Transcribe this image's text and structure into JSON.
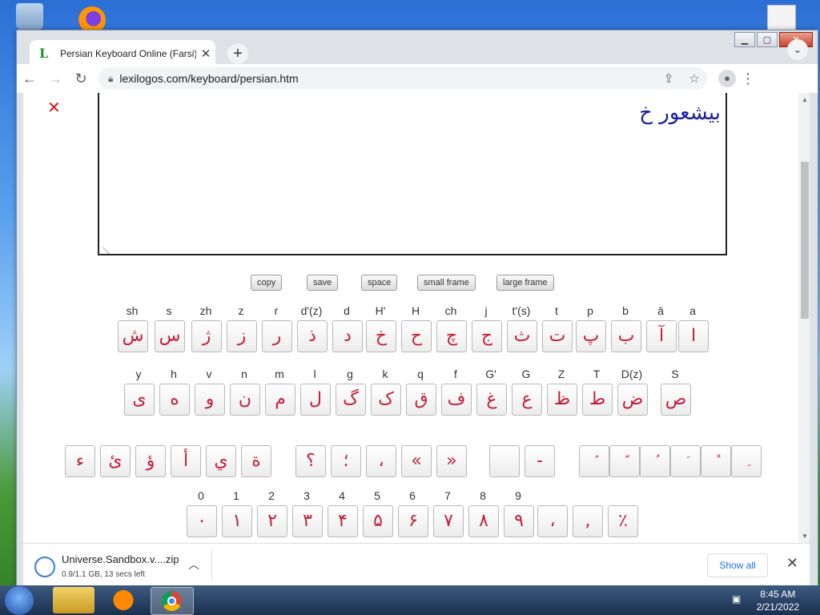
{
  "browser": {
    "tab_title": "Persian Keyboard Online (Farsi) L",
    "tab_favicon": "L",
    "url": "lexilogos.com/keyboard/persian.htm"
  },
  "page": {
    "close_label": "✕",
    "textarea_text": "بیشعور خ",
    "buttons": [
      "copy",
      "save",
      "space",
      "small frame",
      "large frame"
    ],
    "row1_labels": [
      "sh",
      "s",
      "zh",
      "z",
      "r",
      "d'(z)",
      "d",
      "H'",
      "H",
      "ch",
      "j",
      "t'(s)",
      "t",
      "p",
      "b",
      "ā",
      "a"
    ],
    "row1_keys": [
      "ش",
      "س",
      "ژ",
      "ز",
      "ر",
      "ذ",
      "د",
      "خ",
      "ح",
      "چ",
      "ج",
      "ث",
      "ت",
      "پ",
      "ب",
      "آ",
      "ا"
    ],
    "row2_labels": [
      "y",
      "h",
      "v",
      "n",
      "m",
      "l",
      "g",
      "k",
      "q",
      "f",
      "G'",
      "G",
      "Z",
      "T",
      "D(z)",
      "S"
    ],
    "row2_keys": [
      "ی",
      "ه",
      "و",
      "ن",
      "م",
      "ل",
      "گ",
      "ک",
      "ق",
      "ف",
      "غ",
      "ع",
      "ظ",
      "ط",
      "ض",
      "ص"
    ],
    "row3_keys": [
      "ء",
      "ئ",
      "ؤ",
      "أ",
      "ي",
      "ة",
      "؟",
      "؛",
      "،",
      "«",
      "»",
      "",
      "-",
      "ً",
      "ّ",
      "ُ",
      "َ",
      "ْ",
      "ِ"
    ],
    "row4_labels": [
      "0",
      "1",
      "2",
      "3",
      "4",
      "5",
      "6",
      "7",
      "8",
      "9"
    ],
    "row4_keys": [
      "۰",
      "۱",
      "۲",
      "۳",
      "۴",
      "۵",
      "۶",
      "۷",
      "۸",
      "۹",
      "،",
      ",",
      "٪"
    ]
  },
  "download": {
    "filename": "Universe.Sandbox.v....zip",
    "status": "0.9/1.1 GB, 13 secs left",
    "show_all": "Show all"
  },
  "taskbar": {
    "time": "8:45 AM",
    "date": "2/21/2022"
  }
}
